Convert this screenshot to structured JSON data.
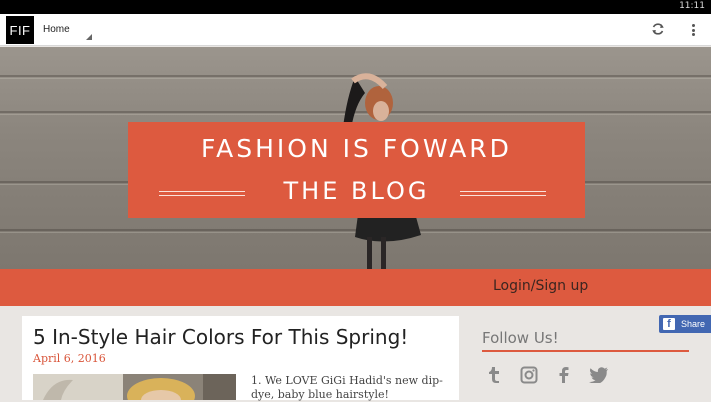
{
  "status_bar": {
    "time": "11:11"
  },
  "app_bar": {
    "logo_text": "FIF",
    "page_selector": "Home",
    "icons": [
      "refresh-icon",
      "more-vert-icon"
    ]
  },
  "hero": {
    "title": "FASHION IS FOWARD",
    "subtitle": "THE BLOG"
  },
  "login_bar": {
    "link": "Login/Sign up"
  },
  "post": {
    "title": "5 In-Style Hair Colors For This Spring!",
    "date": "April 6, 2016",
    "excerpt": "1. We LOVE GiGi Hadid's new dip-dye, baby blue hairstyle!"
  },
  "sidebar": {
    "follow_title": "Follow Us!",
    "social_icons": [
      "tumblr-icon",
      "instagram-icon",
      "facebook-icon",
      "twitter-icon"
    ]
  },
  "share_button": {
    "label": "Share"
  },
  "colors": {
    "accent": "#dd5a3f",
    "facebook": "#4267b2",
    "status_bar": "#000000"
  }
}
